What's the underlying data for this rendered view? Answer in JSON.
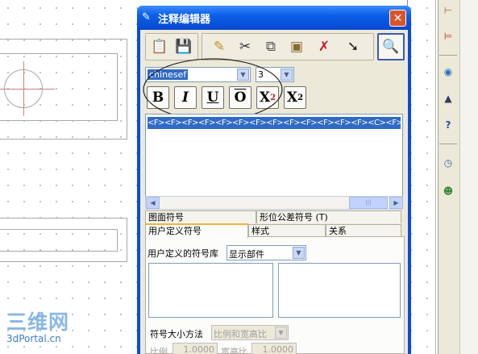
{
  "dialog": {
    "title": "注释编辑器",
    "close_label": "✕"
  },
  "toolbar": {
    "icons": [
      "paste-icon",
      "save-icon",
      "edit-icon",
      "cut-icon",
      "copy-icon",
      "clipboard-icon",
      "delete-icon",
      "insert-icon",
      "preview-icon"
    ]
  },
  "format": {
    "font_value": "chinesef",
    "size_value": "3",
    "bold_label": "B",
    "italic_label": "I",
    "underline_label": "U",
    "overline_label": "O",
    "superscript_base": "X",
    "superscript_exp": "2",
    "subscript_base": "X",
    "subscript_exp": "2"
  },
  "editor": {
    "text": "<F><F><F><F><F><F><F><F><F><F><F><F><F><C><F>"
  },
  "tabs": {
    "tab1": "图面符号",
    "tab2": "形位公差符号 (T)",
    "tab3": "用户定义符号",
    "tab4": "样式",
    "tab5": "关系"
  },
  "panel": {
    "library_label": "用户定义的符号库",
    "library_value": "显示部件",
    "size_method_label": "符号大小方法",
    "size_method_value": "比例和宽高比",
    "scale_label": "比例",
    "scale_value": "1.0000",
    "aspect_label": "宽高比",
    "aspect_value": "1.0000"
  },
  "watermark": {
    "line1": "三维网",
    "line2": "3dPortal.cn"
  }
}
